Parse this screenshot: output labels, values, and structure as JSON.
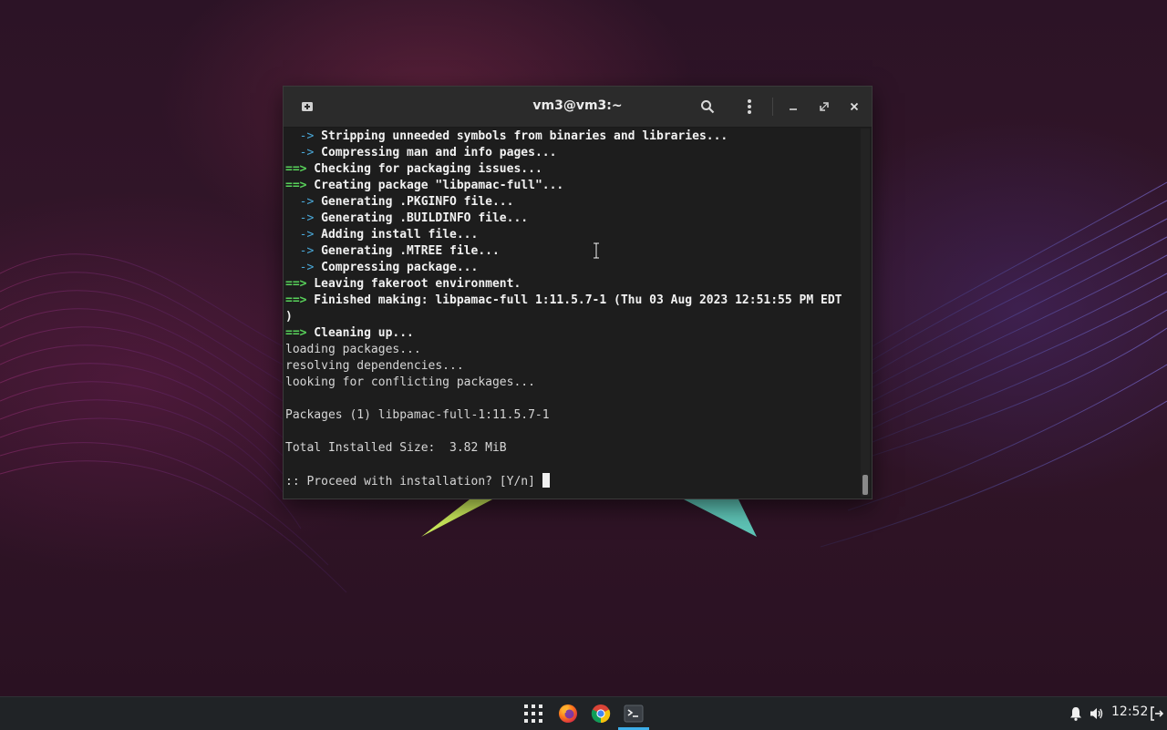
{
  "window": {
    "title": "vm3@vm3:~"
  },
  "terminal": {
    "lines": {
      "l01": {
        "prefix": "  ->",
        "text": " Stripping unneeded symbols from binaries and libraries..."
      },
      "l02": {
        "prefix": "  ->",
        "text": " Compressing man and info pages..."
      },
      "l03": {
        "prefix": "==>",
        "text": " Checking for packaging issues..."
      },
      "l04": {
        "prefix": "==>",
        "text": " Creating package \"libpamac-full\"..."
      },
      "l05": {
        "prefix": "  ->",
        "text": " Generating .PKGINFO file..."
      },
      "l06": {
        "prefix": "  ->",
        "text": " Generating .BUILDINFO file..."
      },
      "l07": {
        "prefix": "  ->",
        "text": " Adding install file..."
      },
      "l08": {
        "prefix": "  ->",
        "text": " Generating .MTREE file..."
      },
      "l09": {
        "prefix": "  ->",
        "text": " Compressing package..."
      },
      "l10": {
        "prefix": "==>",
        "text": " Leaving fakeroot environment."
      },
      "l11": {
        "prefix": "==>",
        "text": " Finished making: libpamac-full 1:11.5.7-1 (Thu 03 Aug 2023 12:51:55 PM EDT"
      },
      "l12": {
        "text": ")"
      },
      "l13": {
        "prefix": "==>",
        "text": " Cleaning up..."
      },
      "l14": {
        "text": "loading packages..."
      },
      "l15": {
        "text": "resolving dependencies..."
      },
      "l16": {
        "text": "looking for conflicting packages..."
      },
      "l17": {
        "text": ""
      },
      "l18": {
        "text": "Packages (1) libpamac-full-1:11.5.7-1"
      },
      "l19": {
        "text": ""
      },
      "l20": {
        "text": "Total Installed Size:  3.82 MiB"
      },
      "l21": {
        "text": ""
      },
      "l22": {
        "text": ":: Proceed with installation? [Y/n] "
      }
    }
  },
  "icons": {
    "new_tab": "new-tab-icon",
    "search": "search-icon",
    "menu": "kebab-menu-icon",
    "minimize": "minimize-icon",
    "restore": "restore-icon",
    "close": "close-icon",
    "apps": "app-grid-icon",
    "firefox": "firefox-icon",
    "chrome": "chrome-icon",
    "terminal": "terminal-icon",
    "bell": "bell-icon",
    "volume": "volume-icon",
    "logout": "logout-icon"
  },
  "colors": {
    "accent": "#3daee9",
    "prompt_arrow": "#58d25a",
    "sub_arrow": "#4aa8d8"
  },
  "taskbar": {
    "clock": "12:52"
  }
}
